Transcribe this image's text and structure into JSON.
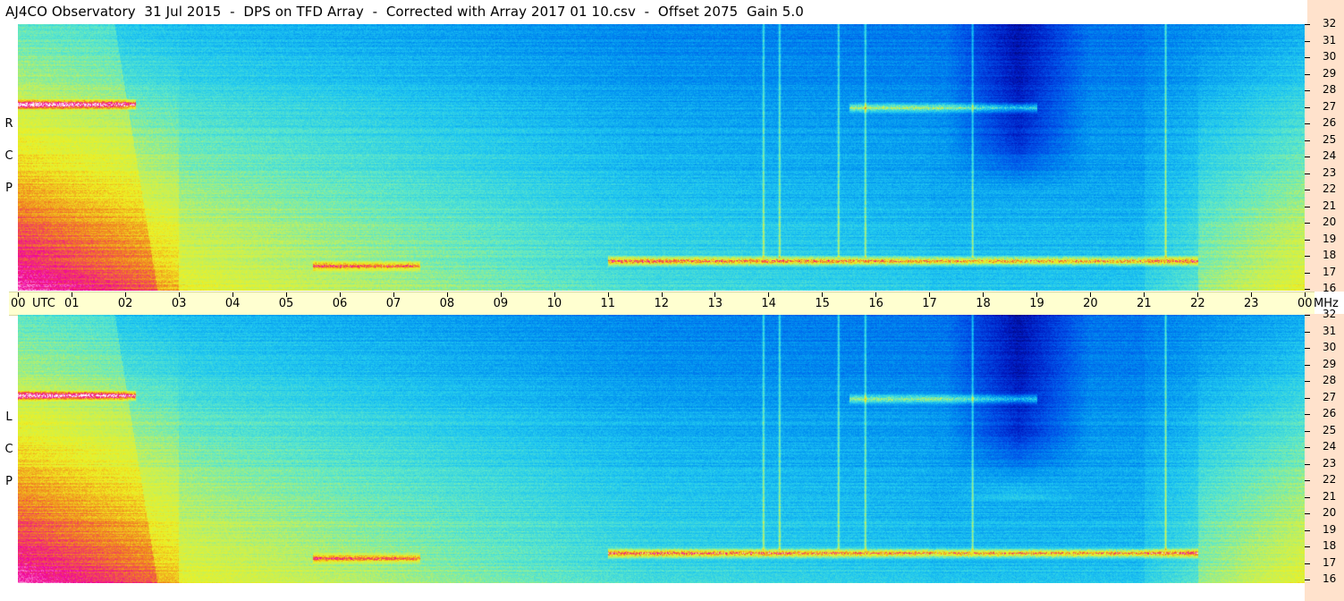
{
  "title": "AJ4CO Observatory  31 Jul 2015  -  DPS on TFD Array  -  Corrected with Array 2017 01 10.csv  -  Offset 2075  Gain 5.0",
  "chart_data": {
    "type": "heatmap",
    "xlabel": "UTC",
    "ylabel": "MHz",
    "x_ticks": [
      "00",
      "01",
      "02",
      "03",
      "04",
      "05",
      "06",
      "07",
      "08",
      "09",
      "10",
      "11",
      "12",
      "13",
      "14",
      "15",
      "16",
      "17",
      "18",
      "19",
      "20",
      "21",
      "22",
      "23",
      "00"
    ],
    "x_range": [
      0,
      24
    ],
    "y_ticks": [
      32,
      31,
      30,
      29,
      28,
      27,
      26,
      25,
      24,
      23,
      22,
      21,
      20,
      19,
      18,
      17,
      16
    ],
    "y_range": [
      16,
      32
    ],
    "panels": [
      {
        "polarization": "RCP",
        "letters": [
          "R",
          "C",
          "P"
        ]
      },
      {
        "polarization": "LCP",
        "letters": [
          "L",
          "C",
          "P"
        ]
      }
    ],
    "colormap": [
      "#000060",
      "#0018c0",
      "#0050e8",
      "#0090f0",
      "#20c8f0",
      "#60e8c8",
      "#c0f060",
      "#f0f020",
      "#f08020",
      "#f000a0",
      "#ffffff"
    ],
    "features": [
      {
        "kind": "bright band",
        "freq_mhz": 27.2,
        "utc": [
          0,
          2.2
        ],
        "level": "high"
      },
      {
        "kind": "bright band",
        "freq_mhz": 17.5,
        "utc": [
          5.5,
          7.5
        ],
        "level": "medium"
      },
      {
        "kind": "bright band",
        "freq_mhz": 17.8,
        "utc": [
          11,
          22
        ],
        "level": "high"
      },
      {
        "kind": "bright band",
        "freq_mhz": 27.0,
        "utc": [
          15.5,
          19
        ],
        "level": "medium"
      },
      {
        "kind": "vertical stripe",
        "utc": 13.9
      },
      {
        "kind": "vertical stripe",
        "utc": 14.2
      },
      {
        "kind": "vertical stripe",
        "utc": 15.3
      },
      {
        "kind": "vertical stripe",
        "utc": 15.8
      },
      {
        "kind": "vertical stripe",
        "utc": 17.8
      },
      {
        "kind": "vertical stripe",
        "utc": 21.4
      },
      {
        "kind": "dark region",
        "utc": [
          17.3,
          20
        ],
        "freq_mhz": [
          22,
          32
        ]
      }
    ]
  }
}
